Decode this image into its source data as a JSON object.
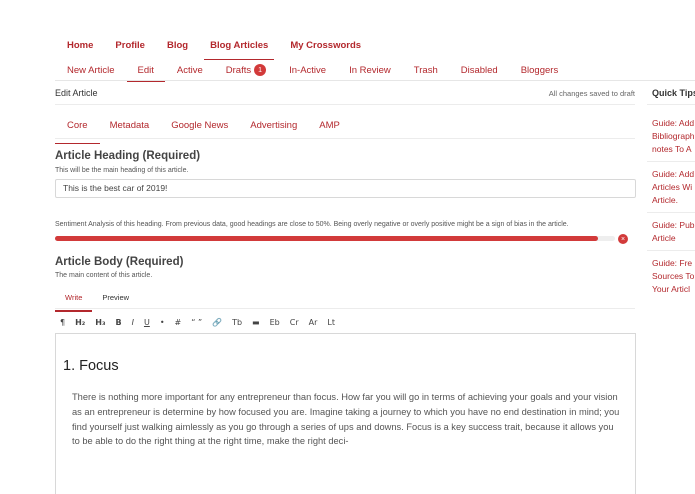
{
  "top_nav": [
    "Home",
    "Profile",
    "Blog",
    "Blog Articles",
    "My Crosswords"
  ],
  "sub_nav": {
    "items": [
      "New Article",
      "Edit",
      "Active",
      "Drafts",
      "In-Active",
      "In Review",
      "Trash",
      "Disabled",
      "Bloggers"
    ],
    "drafts_badge": "1"
  },
  "section": {
    "title": "Edit Article",
    "status": "All changes saved to draft"
  },
  "tabs": [
    "Core",
    "Metadata",
    "Google News",
    "Advertising",
    "AMP"
  ],
  "heading": {
    "title": "Article Heading (Required)",
    "subtitle": "This will be the main heading of this article.",
    "value": "This is the best car of 2019!"
  },
  "sentiment": {
    "text": "Sentiment Analysis of this heading. From previous data, good headings are close to 50%. Being overly negative or overly positive might be a sign of bias in the article.",
    "level": 0.97,
    "close_glyph": "×",
    "color": "#d23a3a"
  },
  "body": {
    "title": "Article Body (Required)",
    "subtitle": "The main content of this article.",
    "write_tab": "Write",
    "preview_tab": "Preview"
  },
  "toolbar": [
    "¶",
    "H₂",
    "H₃",
    "B",
    "I",
    "U",
    "•",
    "#",
    "“ ”",
    "🔗",
    "Tb",
    "▬",
    "Eb",
    "Cr",
    "Ar",
    "Lt"
  ],
  "editor": {
    "heading": "1. Focus",
    "paragraph": "There is nothing more important for any entrepreneur than focus. How far you will go in terms of achieving your goals and your vision as an entrepreneur is determine by how focused you are. Imagine taking a journey to which you have no end destination in mind; you find yourself just walking aimlessly as you go through a series of ups and downs. Focus is a key success trait, because it allows you to be able to do the right thing at the right time, make the right deci-"
  },
  "sidebar": {
    "title": "Quick Tips",
    "tips": [
      [
        "Guide: Add",
        "Bibliograph",
        "notes To A"
      ],
      [
        "Guide: Add",
        "Articles Wi",
        "Article."
      ],
      [
        "Guide: Pub",
        "Article"
      ],
      [
        "Guide: Fre",
        "Sources To",
        "Your Articl"
      ]
    ]
  },
  "colors": {
    "accent": "#b3282d"
  }
}
